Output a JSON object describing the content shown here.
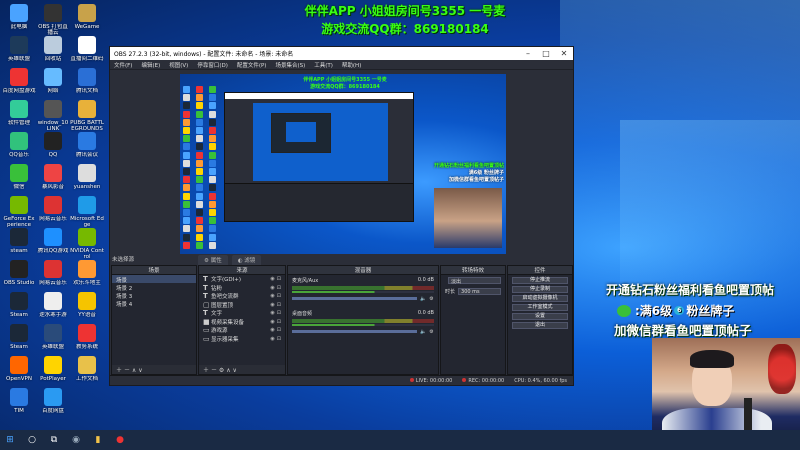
{
  "overlay_top": {
    "line1": "伴伴APP 小姐姐房间号3355 一号麦",
    "line2": "游戏交流QQ群：869180184"
  },
  "desktop_icons": [
    {
      "label": "此电脑",
      "color": "#4aa3ff"
    },
    {
      "label": "OBS 打包直播云",
      "color": "#333"
    },
    {
      "label": "WeGame",
      "color": "#c8a24a"
    },
    {
      "label": "英雄联盟",
      "color": "#1d3a5a"
    },
    {
      "label": "回收站",
      "color": "#bcd"
    },
    {
      "label": "直播间二维码",
      "color": "#fff"
    },
    {
      "label": "百度网盘游戏",
      "color": "#e33"
    },
    {
      "label": "网络",
      "color": "#6bf"
    },
    {
      "label": "腾讯文档",
      "color": "#2a6fd6"
    },
    {
      "label": "软件管理",
      "color": "#3c9"
    },
    {
      "label": "window_10 LINK",
      "color": "#555"
    },
    {
      "label": "PUBG BATTLEGROUNDS",
      "color": "#e8b13a"
    },
    {
      "label": "QQ音乐",
      "color": "#31c27c"
    },
    {
      "label": "QQ",
      "color": "#222"
    },
    {
      "label": "腾讯会议",
      "color": "#2a7ae2"
    },
    {
      "label": "微信",
      "color": "#39c03a"
    },
    {
      "label": "暴风影音",
      "color": "#e44"
    },
    {
      "label": "yuanshen",
      "color": "#ddd"
    },
    {
      "label": "GeForce Experience",
      "color": "#76b900"
    },
    {
      "label": "网易云音乐",
      "color": "#d33"
    },
    {
      "label": "Microsoft Edge",
      "color": "#1f9be8"
    },
    {
      "label": "steam",
      "color": "#1b2838"
    },
    {
      "label": "腾讯QQ游戏",
      "color": "#1e90ff"
    },
    {
      "label": "NVIDIA Control",
      "color": "#76b900"
    },
    {
      "label": "OBS Studio",
      "color": "#222"
    },
    {
      "label": "网易云音乐",
      "color": "#d33"
    },
    {
      "label": "欢乐斗地主",
      "color": "#f93"
    },
    {
      "label": "Steam",
      "color": "#1b2838"
    },
    {
      "label": "逆水寒手游",
      "color": "#eee"
    },
    {
      "label": "YY语音",
      "color": "#f5c400"
    },
    {
      "label": "Steam",
      "color": "#1b2838"
    },
    {
      "label": "英雄联盟",
      "color": "#2a4b7a"
    },
    {
      "label": "教务系统",
      "color": "#e33"
    },
    {
      "label": "OpenVPN",
      "color": "#f60"
    },
    {
      "label": "PotPlayer",
      "color": "#ffd400"
    },
    {
      "label": "工作文档",
      "color": "#e8c14a"
    },
    {
      "label": "TIM",
      "color": "#2a7ae2"
    },
    {
      "label": "百度网盘",
      "color": "#2a9af2"
    }
  ],
  "obs": {
    "title": "OBS 27.2.3 (32-bit, windows) - 配置文件: 未命名 - 场景: 未命名",
    "menus": [
      "文件(F)",
      "编辑(E)",
      "视图(V)",
      "停靠窗口(D)",
      "配置文件(P)",
      "场景集合(S)",
      "工具(T)",
      "帮助(H)"
    ],
    "no_scene": "未选择源",
    "tabs": [
      "属性",
      "滤镜"
    ],
    "preview": {
      "overlay1": "伴伴APP 小姐姐房间号3355 一号麦",
      "overlay2": "游戏交流QQ群：869180184",
      "promo_line1": "开通钻石粉丝福利看鱼吧置顶帖",
      "promo_line2": "满6级 粉丝牌子",
      "promo_line3": "加微信群看鱼吧置顶帖子"
    },
    "scenes": {
      "header": "场景",
      "items": [
        "场景",
        "场景 2",
        "场景 3",
        "场景 4"
      ]
    },
    "sources": {
      "header": "来源",
      "items": [
        {
          "icon": "T",
          "name": "文字(GDI+)"
        },
        {
          "icon": "T",
          "name": "钻粉"
        },
        {
          "icon": "T",
          "name": "鱼吧交流群"
        },
        {
          "icon": "▢",
          "name": "图层置顶"
        },
        {
          "icon": "T",
          "name": "文字"
        },
        {
          "icon": "■",
          "name": "视频采集设备"
        },
        {
          "icon": "▭",
          "name": "游戏源"
        },
        {
          "icon": "▭",
          "name": "显示器采集"
        }
      ]
    },
    "mixer": {
      "header": "混音器",
      "channels": [
        {
          "name": "麦克风/Aux",
          "db": "0.0 dB"
        },
        {
          "name": "桌面音频",
          "db": "0.0 dB"
        }
      ]
    },
    "transitions": {
      "header": "转场特效",
      "type_label": "淡出",
      "duration_label": "时长",
      "duration_value": "300 ms"
    },
    "controls": {
      "header": "控件",
      "buttons": [
        "停止推流",
        "停止录制",
        "启动虚拟摄像机",
        "工作室模式",
        "设置",
        "退出"
      ]
    },
    "status": {
      "live": "LIVE: 00:00:00",
      "rec": "REC: 00:00:00",
      "cpu": "CPU: 0.4%, 60.00 fps"
    }
  },
  "overlay_right": {
    "line1": "开通钻石粉丝福利看鱼吧置顶帖",
    "line2_left": ":满6级",
    "line2_badge": "6",
    "line2_right": "粉丝牌子",
    "line3": "加微信群看鱼吧置顶帖子"
  },
  "taskbar": {
    "items": [
      "windows-logo",
      "search",
      "task-view",
      "steam",
      "file-explorer",
      "obs"
    ]
  }
}
